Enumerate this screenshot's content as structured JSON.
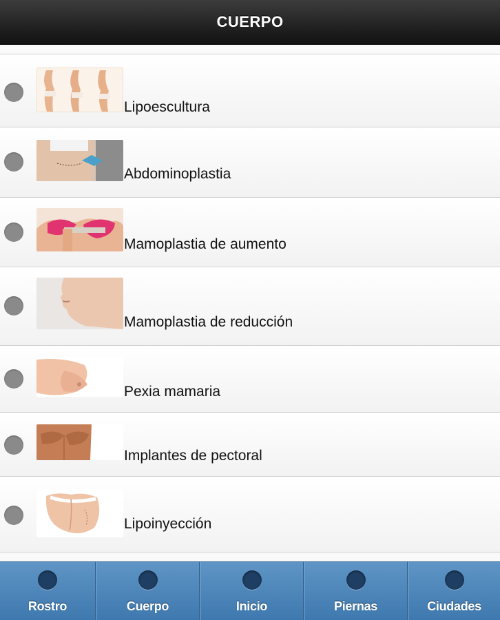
{
  "header": {
    "title": "CUERPO"
  },
  "list": {
    "items": [
      {
        "label": "Lipoescultura",
        "image": "body-contour-thumbnail"
      },
      {
        "label": "Abdominoplastia",
        "image": "abdomen-marking-thumbnail"
      },
      {
        "label": "Mamoplastia de aumento",
        "image": "breast-measure-thumbnail"
      },
      {
        "label": "Mamoplastia de reducción",
        "image": "face-profile-thumbnail"
      },
      {
        "label": "Pexia mamaria",
        "image": "breast-thumbnail"
      },
      {
        "label": "Implantes de pectoral",
        "image": "male-chest-thumbnail"
      },
      {
        "label": "Lipoinyección",
        "image": "buttocks-thumbnail"
      }
    ]
  },
  "navbar": {
    "items": [
      {
        "label": "Rostro",
        "icon": "circle-icon"
      },
      {
        "label": "Cuerpo",
        "icon": "circle-icon"
      },
      {
        "label": "Inicio",
        "icon": "circle-icon"
      },
      {
        "label": "Piernas",
        "icon": "circle-icon"
      },
      {
        "label": "Ciudades",
        "icon": "circle-icon"
      }
    ]
  },
  "colors": {
    "header_bg": "#1a1a1a",
    "navbar_bg": "#4a86be",
    "radio_dot": "#8a8a8a",
    "nav_icon": "#1e3f63"
  }
}
